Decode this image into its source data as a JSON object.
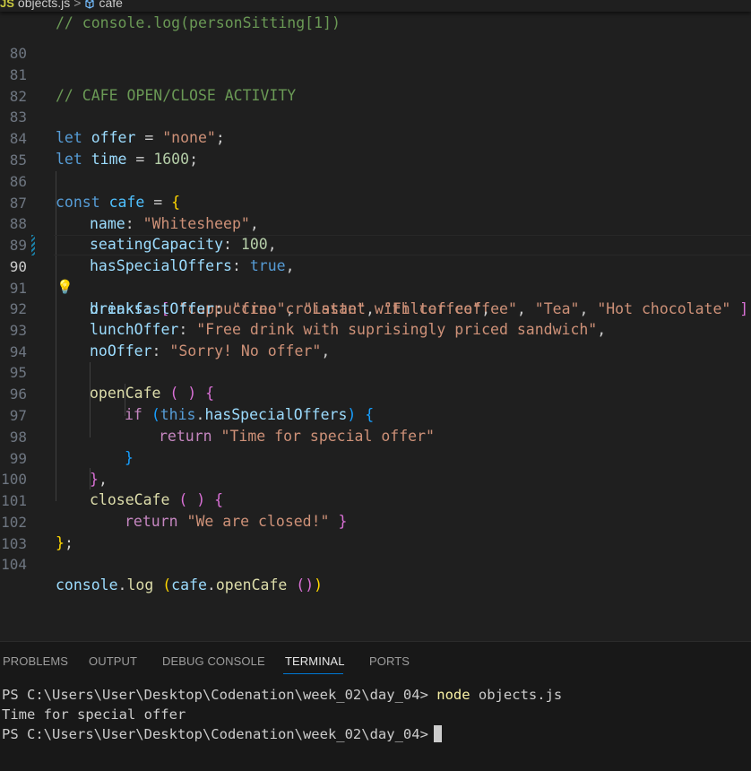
{
  "breadcrumb": {
    "file_icon": "JS",
    "file": "objects.js",
    "separator": ">",
    "symbol_icon": "variable-cube-icon",
    "symbol": "cafe"
  },
  "editor": {
    "top_partial_line": "// console.log(personSitting[1])",
    "active_line": 90,
    "lines": [
      {
        "n": "80"
      },
      {
        "n": "81"
      },
      {
        "n": "82"
      },
      {
        "n": "83"
      },
      {
        "n": "84"
      },
      {
        "n": "85"
      },
      {
        "n": "86"
      },
      {
        "n": "87"
      },
      {
        "n": "88"
      },
      {
        "n": "89"
      },
      {
        "n": "90"
      },
      {
        "n": "91"
      },
      {
        "n": "92"
      },
      {
        "n": "93"
      },
      {
        "n": "94"
      },
      {
        "n": "95"
      },
      {
        "n": "96"
      },
      {
        "n": "97"
      },
      {
        "n": "98"
      },
      {
        "n": "99"
      },
      {
        "n": "100"
      },
      {
        "n": "101"
      },
      {
        "n": "102"
      },
      {
        "n": "103"
      },
      {
        "n": "104"
      }
    ],
    "code": {
      "l81_comment": "// CAFE OPEN/CLOSE ACTIVITY",
      "l83_kw": "let",
      "l83_var": "offer",
      "l83_op": " = ",
      "l83_str": "\"none\"",
      "l83_end": ";",
      "l84_kw": "let",
      "l84_var": "time",
      "l84_op": " = ",
      "l84_num": "1600",
      "l84_end": ";",
      "l86_kw": "const",
      "l86_var": "cafe",
      "l86_op": " = ",
      "l86_brace": "{",
      "l87_key": "name",
      "l87_colon": ": ",
      "l87_str": "\"Whitesheep\"",
      "l87_end": ",",
      "l88_key": "seatingCapacity",
      "l88_colon": ": ",
      "l88_num": "100",
      "l88_end": ",",
      "l89_key": "hasSpecialOffers",
      "l89_colon": ": ",
      "l89_val": "true",
      "l89_end": ",",
      "l90_key": "drinks",
      "l90_colon": ": ",
      "l90_open": "[",
      "l90_s1": "\"cappuccino\"",
      "l90_s2": "\"Latte\"",
      "l90_s3": "\"Filter coffee\"",
      "l90_s4": "\"Tea\"",
      "l90_s5": "\"Hot chocolate\"",
      "l90_close": "]",
      "l90_comma": ",",
      "l90_sep": ", ",
      "l91_key": "breakfastOffer",
      "l91_colon": ": ",
      "l91_str": "\"free croissant with coffee\"",
      "l91_end": ",",
      "l92_key": "lunchOffer",
      "l92_colon": ": ",
      "l92_str": "\"Free drink with suprisingly priced sandwich\"",
      "l92_end": ",",
      "l93_key": "noOffer",
      "l93_colon": ": ",
      "l93_str": "\"Sorry! No offer\"",
      "l93_end": ",",
      "l95_fn": "openCafe",
      "l95_parens": "( )",
      "l95_brace": "{",
      "l96_kw": "if",
      "l96_open": "(",
      "l96_this": "this",
      "l96_dot": ".",
      "l96_prop": "hasSpecialOffers",
      "l96_close": ")",
      "l96_brace": "{",
      "l97_kw": "return",
      "l97_str": "\"Time for special offer\"",
      "l98_brace": "}",
      "l99_brace": "}",
      "l99_end": ",",
      "l100_fn": "closeCafe",
      "l100_parens": "( )",
      "l100_brace": "{",
      "l101_kw": "return",
      "l101_str": "\"We are closed!\"",
      "l101_brace": "}",
      "l102_brace": "}",
      "l102_end": ";",
      "l104_obj": "console",
      "l104_dot": ".",
      "l104_fn": "log",
      "l104_open": "(",
      "l104_cafe": "cafe",
      "l104_dot2": ".",
      "l104_fn2": "openCafe",
      "l104_call": "()",
      "l104_close": ")"
    }
  },
  "panel": {
    "tabs": [
      {
        "label": "PROBLEMS"
      },
      {
        "label": "OUTPUT"
      },
      {
        "label": "DEBUG CONSOLE"
      },
      {
        "label": "TERMINAL",
        "active": true
      },
      {
        "label": "PORTS"
      }
    ],
    "terminal": {
      "prompt1": "PS C:\\Users\\User\\Desktop\\Codenation\\week_02\\day_04> ",
      "cmd1_node": "node",
      "cmd1_arg": " objects.js",
      "output1": "Time for special offer",
      "prompt2": "PS C:\\Users\\User\\Desktop\\Codenation\\week_02\\day_04>"
    }
  },
  "colors": {
    "editor_bg": "#1f1f1f",
    "panel_bg": "#181818",
    "accent": "#0078d4",
    "string": "#ce9178",
    "keyword": "#569cd6",
    "property": "#9cdcfe"
  }
}
